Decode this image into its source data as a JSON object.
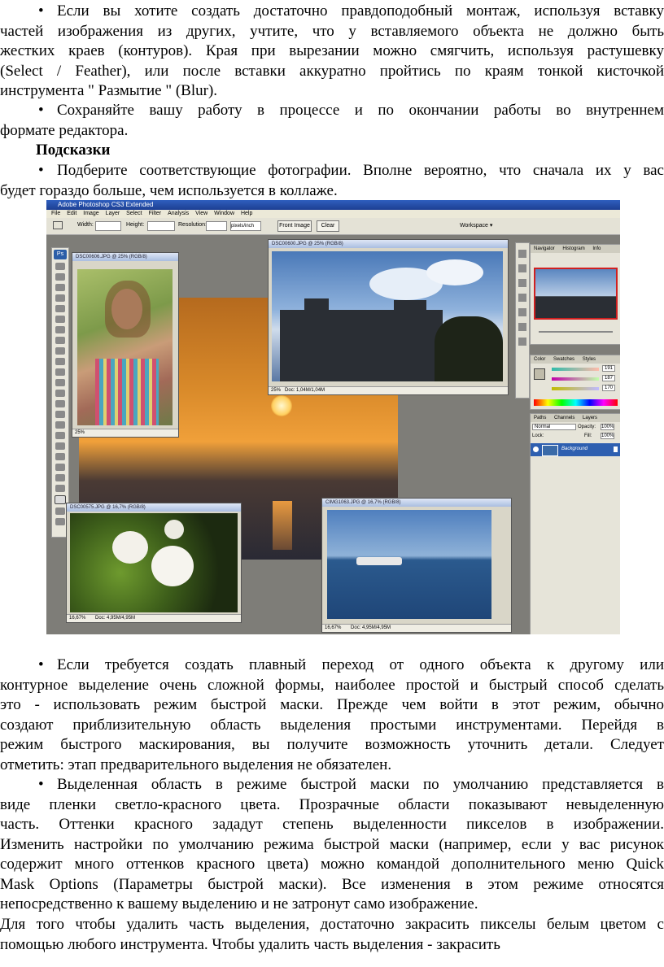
{
  "text_top": {
    "b1": [
      "Если вы хотите создать достаточно правдоподобный монтаж, используя вставку",
      "частей изображения из других, учтите, что у вставляемого объекта не должно быть",
      "жестких краев (контуров). Края при вырезании можно смягчить, используя растушевку",
      "(Select / Feather), или после вставки аккуратно пройтись по краям тонкой кисточкой",
      "инструмента \" Размытие \" (Blur)."
    ],
    "b2": [
      "Сохраняйте вашу работу в процессе и по окончании работы во внутреннем",
      "формате редактора."
    ],
    "heading": "Подсказки",
    "b3": [
      "Подберите соответствующие фотографии. Вполне вероятно, что сначала их у вас",
      "будет гораздо больше, чем используется в коллаже."
    ]
  },
  "bullet_char": "•",
  "screenshot": {
    "app_title": "Adobe Photoshop CS3 Extended",
    "menu": [
      "File",
      "Edit",
      "Image",
      "Layer",
      "Select",
      "Filter",
      "Analysis",
      "View",
      "Window",
      "Help"
    ],
    "options": {
      "width_label": "Width:",
      "height_label": "Height:",
      "resolution_label": "Resolution:",
      "unit": "pixels/inch",
      "front_image": "Front Image",
      "clear": "Clear",
      "workspace": "Workspace ▾"
    },
    "toolbox_logo": "Ps",
    "windows": {
      "girl": {
        "title": "DSC00606.JPG @ 25% (RGB/8)",
        "status": "25%"
      },
      "castle": {
        "title": "DSC00600.JPG @ 25% (RGB/8)",
        "status": "25%",
        "doc": "Doc: 1,04M/1,04M"
      },
      "sunset": {
        "title": ""
      },
      "roses": {
        "title": "DSC00575.JPG @ 16,7% (RGB/8)",
        "status": "16,67%",
        "doc": "Doc: 4,95M/4,95M"
      },
      "sea": {
        "title": "CIMG1063.JPG @ 16,7% (RGB/8)",
        "status": "16,67%",
        "doc": "Doc: 4,95M/4,95M"
      }
    },
    "panels": {
      "nav_tabs": [
        "Navigator",
        "Histogram",
        "Info"
      ],
      "color_tabs": [
        "Color",
        "Swatches",
        "Styles"
      ],
      "color_values": [
        "191",
        "187",
        "170"
      ],
      "layer_tabs": [
        "Paths",
        "Channels",
        "Layers"
      ],
      "blend_mode": "Normal",
      "opacity_label": "Opacity:",
      "opacity": "100%",
      "lock_label": "Lock:",
      "fill_label": "Fill:",
      "fill": "100%",
      "layer_name": "Background"
    }
  },
  "text_bottom": {
    "b4": [
      "Если требуется создать плавный переход от одного объекта к другому или",
      "контурное выделение очень сложной формы, наиболее простой и быстрый способ сделать",
      "это - использовать режим быстрой маски. Прежде чем войти в этот режим, обычно",
      "создают приблизительную область выделения простыми инструментами. Перейдя в",
      "режим быстрого маскирования, вы получите возможность уточнить детали. Следует",
      "отметить: этап предварительного выделения не обязателен."
    ],
    "b5": [
      "Выделенная область в режиме быстрой маски по умолчанию представляется в",
      "виде пленки светло-красного цвета. Прозрачные области показывают невыделенную",
      "часть. Оттенки красного зададут степень выделенности пикселов в изображении.",
      "Изменить настройки по умолчанию режима быстрой маски (например, если у вас рисунок",
      "содержит много оттенков красного цвета) можно командой дополнительного меню Quick",
      "Mask Options (Параметры быстрой маски). Все изменения в этом режиме относятся",
      "непосредственно к вашему выделению и не затронут само изображение."
    ],
    "tail": [
      "Для того чтобы удалить часть выделения, достаточно закрасить пикселы белым цветом с",
      "помощью любого инструмента. Чтобы удалить часть выделения - закрасить"
    ]
  }
}
